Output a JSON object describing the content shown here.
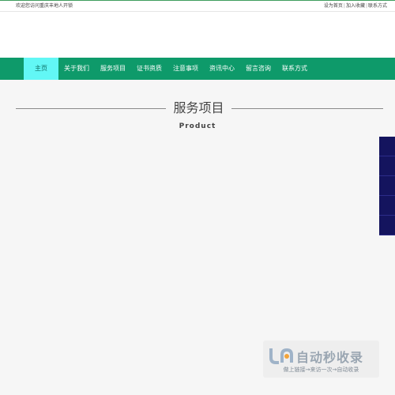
{
  "topbar": {
    "welcome": "欢迎您访问重庆丰地人开锁",
    "links": [
      "设为首页",
      "加入收藏",
      "联系方式"
    ]
  },
  "nav": {
    "items": [
      "主页",
      "关于我们",
      "服务项目",
      "证书资质",
      "注意事项",
      "资讯中心",
      "留言咨询",
      "联系方式"
    ],
    "active_index": 0
  },
  "section": {
    "title": "服务项目",
    "subtitle": "Product"
  },
  "watermark": {
    "brand": "自动秒收录",
    "slogan": "做上链接→来访一次→自动收录"
  },
  "colors": {
    "nav_bg": "#0e9a6a",
    "nav_active": "#62f7f5",
    "side_tab": "#14145e"
  }
}
